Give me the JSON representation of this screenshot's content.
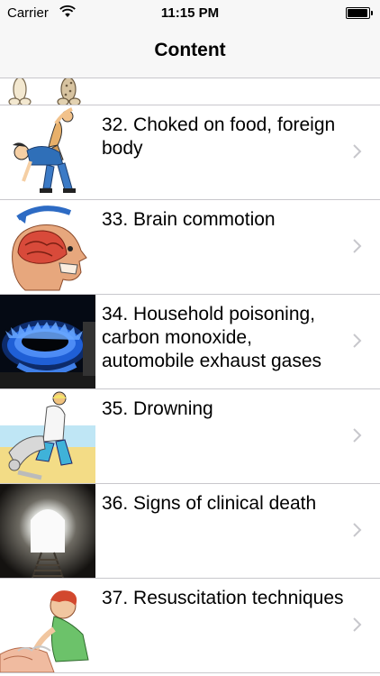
{
  "status_bar": {
    "carrier": "Carrier",
    "time": "11:15 PM"
  },
  "nav": {
    "title": "Content"
  },
  "items": [
    {
      "title": "32. Choked on food, foreign body",
      "icon": "choking-first-aid-illustration"
    },
    {
      "title": "33. Brain commotion",
      "icon": "brain-head-illustration"
    },
    {
      "title": "34. Household poisoning, carbon monoxide, automobile exhaust gases",
      "icon": "gas-burner-flame-photo"
    },
    {
      "title": "35. Drowning",
      "icon": "drowning-rescue-illustration"
    },
    {
      "title": "36. Signs of clinical death",
      "icon": "light-tunnel-photo"
    },
    {
      "title": "37. Resuscitation techniques",
      "icon": "resuscitation-illustration"
    }
  ],
  "colors": {
    "bar_background": "#f7f7f7",
    "separator": "#c8c7cc",
    "chevron": "#c7c7cc"
  }
}
